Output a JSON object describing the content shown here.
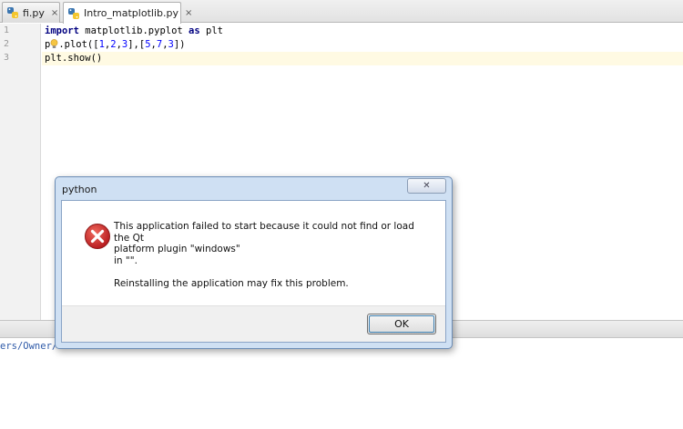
{
  "tabs": [
    {
      "label": "fi.py",
      "icon": "python-file-icon",
      "active": false
    },
    {
      "label": "Intro_matplotlib.py",
      "icon": "python-file-icon",
      "active": true
    }
  ],
  "tab_close_glyph": "×",
  "editor": {
    "line_numbers": [
      "1",
      "2",
      "3"
    ],
    "lines": [
      {
        "kw": "import",
        "rest": " matplotlib.pyplot ",
        "kw2": "as",
        "rest2": " plt"
      },
      {
        "pre": "p",
        "post": ".plot([",
        "n1": "1",
        "c1": ",",
        "n2": "2",
        "c2": ",",
        "n3": "3",
        "c3": "],[",
        "n4": "5",
        "c4": ",",
        "n5": "7",
        "c5": ",",
        "n6": "3",
        "c6": "])"
      },
      {
        "text": "plt.show()"
      }
    ]
  },
  "console": {
    "path_line": "ers/Owner/"
  },
  "dialog": {
    "title": "python",
    "message_line1": "This application failed to start because it could not find or load the Qt",
    "message_line2": "platform plugin \"windows\"",
    "message_line3": "in \"\".",
    "message_line4": "Reinstalling the application may fix this problem.",
    "ok_label": "OK",
    "close_glyph": "✕"
  },
  "colors": {
    "keyword": "#000080",
    "number": "#0000ff",
    "error_red": "#d62a2a",
    "dialog_frame": "#cfe0f3"
  }
}
